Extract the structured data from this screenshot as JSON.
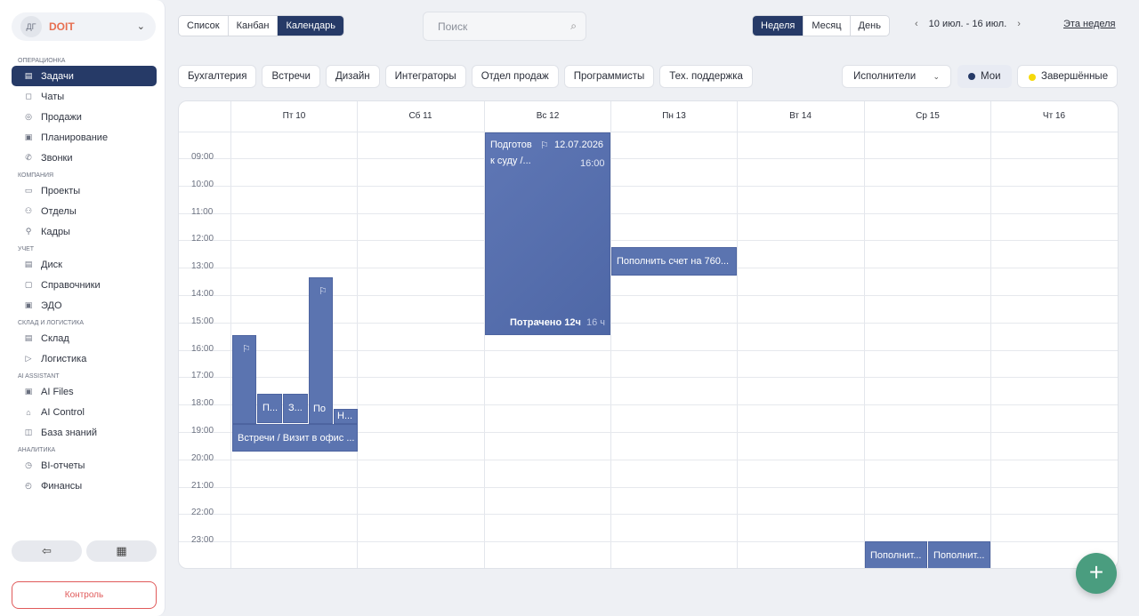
{
  "sidebar": {
    "org": {
      "initials": "ДГ",
      "name": "DOIT"
    },
    "sections": [
      {
        "title": "ОПЕРАЦИОНКА",
        "items": [
          {
            "label": "Задачи",
            "icon": "tasks-icon",
            "glyph": "▤",
            "active": true
          },
          {
            "label": "Чаты",
            "icon": "chat-icon",
            "glyph": "◻"
          },
          {
            "label": "Продажи",
            "icon": "sales-icon",
            "glyph": "◎"
          },
          {
            "label": "Планирование",
            "icon": "planning-icon",
            "glyph": "▣"
          },
          {
            "label": "Звонки",
            "icon": "phone-icon",
            "glyph": "✆"
          }
        ]
      },
      {
        "title": "КОМПАНИЯ",
        "items": [
          {
            "label": "Проекты",
            "icon": "folder-icon",
            "glyph": "▭"
          },
          {
            "label": "Отделы",
            "icon": "departments-icon",
            "glyph": "⚇"
          },
          {
            "label": "Кадры",
            "icon": "staff-icon",
            "glyph": "⚲"
          }
        ]
      },
      {
        "title": "УЧЕТ",
        "items": [
          {
            "label": "Диск",
            "icon": "disk-icon",
            "glyph": "▤"
          },
          {
            "label": "Справочники",
            "icon": "book-icon",
            "glyph": "▢"
          },
          {
            "label": "ЭДО",
            "icon": "document-icon",
            "glyph": "▣"
          }
        ]
      },
      {
        "title": "СКЛАД И ЛОГИСТИКА",
        "items": [
          {
            "label": "Склад",
            "icon": "warehouse-icon",
            "glyph": "▤"
          },
          {
            "label": "Логистика",
            "icon": "logistics-icon",
            "glyph": "▷"
          }
        ]
      },
      {
        "title": "AI ASSISTANT",
        "items": [
          {
            "label": "AI Files",
            "icon": "ai-files-icon",
            "glyph": "▣"
          },
          {
            "label": "AI Control",
            "icon": "ai-control-icon",
            "glyph": "⌂"
          },
          {
            "label": "База знаний",
            "icon": "knowledge-icon",
            "glyph": "◫"
          }
        ]
      },
      {
        "title": "АНАЛИТИКА",
        "items": [
          {
            "label": "BI-отчеты",
            "icon": "bi-reports-icon",
            "glyph": "◷"
          },
          {
            "label": "Финансы",
            "icon": "finance-icon",
            "glyph": "◴"
          }
        ]
      }
    ],
    "control_label": "Контроль"
  },
  "views": [
    "Список",
    "Канбан",
    "Календарь"
  ],
  "active_view": "Календарь",
  "search": {
    "placeholder": "Поиск"
  },
  "periods": [
    "Неделя",
    "Месяц",
    "День"
  ],
  "active_period": "Неделя",
  "date_range": "10 июл. - 16 июл.",
  "this_week": "Эта неделя",
  "filters": [
    "Бухгалтерия",
    "Встречи",
    "Дизайн",
    "Интеграторы",
    "Отдел продаж",
    "Программисты",
    "Тех. поддержка"
  ],
  "assignees_label": "Исполнители",
  "mine_label": "Мои",
  "completed_label": "Завершённые",
  "colors": {
    "accent": "#263a67",
    "event": "#5b74b0",
    "fab": "#4a9d7f",
    "control": "#e05a5a",
    "mine_dot": "#263a67",
    "completed_dot": "#f5d90a"
  },
  "calendar": {
    "days": [
      "Пт 10",
      "Сб 11",
      "Вс 12",
      "Пн 13",
      "Вт 14",
      "Ср 15",
      "Чт 16"
    ],
    "hours": [
      "09:00",
      "10:00",
      "11:00",
      "12:00",
      "13:00",
      "14:00",
      "15:00",
      "16:00",
      "17:00",
      "18:00",
      "19:00",
      "20:00",
      "21:00",
      "22:00",
      "23:00"
    ],
    "events": [
      {
        "title": "Подготов",
        "title2": "к суду /...",
        "date": "12.07.2026",
        "time": "16:00",
        "spent": "Потрачено 12ч",
        "spent_extra": "16 ч"
      },
      {
        "title": "Пополнить счет на 760..."
      },
      {
        "title": "П..."
      },
      {
        "title": "З..."
      },
      {
        "title": "По"
      },
      {
        "title": "Н..."
      },
      {
        "title": "Встречи / Визит в офис ..."
      },
      {
        "title": "Пополнит..."
      },
      {
        "title": "Пополнит..."
      }
    ]
  }
}
